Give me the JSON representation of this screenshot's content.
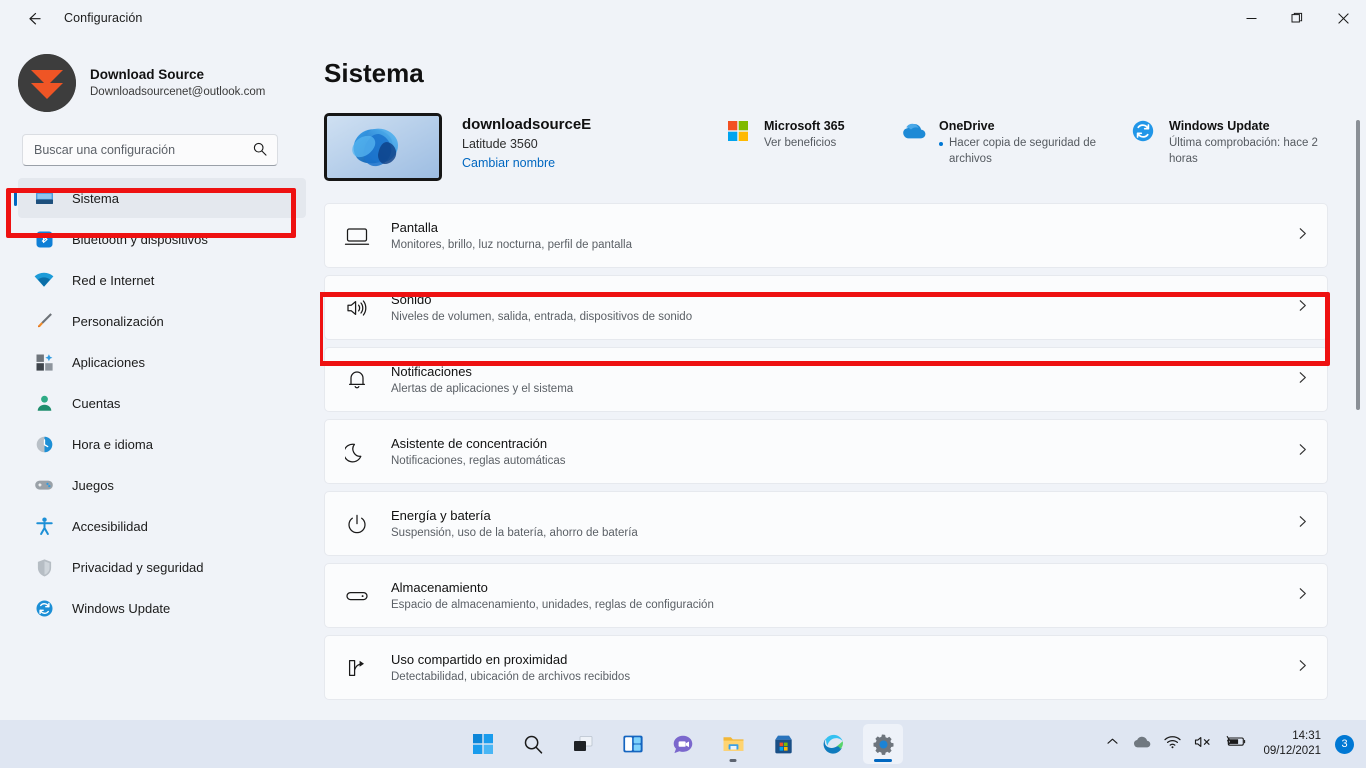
{
  "window": {
    "title": "Configuración",
    "back_icon": "back-arrow-icon",
    "minimize_label": "—",
    "maximize_label": "▢",
    "close_label": "✕"
  },
  "account": {
    "name": "Download Source",
    "email": "Downloadsourcenet@outlook.com",
    "avatar_icon": "download-chevrons-avatar"
  },
  "search": {
    "placeholder": "Buscar una configuración",
    "value": "",
    "icon": "search-icon"
  },
  "sidebar": {
    "items": [
      {
        "label": "Sistema",
        "icon": "monitor-icon",
        "selected": true
      },
      {
        "label": "Bluetooth y dispositivos",
        "icon": "bluetooth-icon",
        "selected": false
      },
      {
        "label": "Red e Internet",
        "icon": "wifi-icon",
        "selected": false
      },
      {
        "label": "Personalización",
        "icon": "paintbrush-icon",
        "selected": false
      },
      {
        "label": "Aplicaciones",
        "icon": "apps-grid-icon",
        "selected": false
      },
      {
        "label": "Cuentas",
        "icon": "person-icon",
        "selected": false
      },
      {
        "label": "Hora e idioma",
        "icon": "clock-icon",
        "selected": false
      },
      {
        "label": "Juegos",
        "icon": "gamepad-icon",
        "selected": false
      },
      {
        "label": "Accesibilidad",
        "icon": "accessibility-person-icon",
        "selected": false
      },
      {
        "label": "Privacidad y seguridad",
        "icon": "shield-icon",
        "selected": false
      },
      {
        "label": "Windows Update",
        "icon": "update-refresh-icon",
        "selected": false
      }
    ]
  },
  "main": {
    "page_title": "Sistema",
    "device": {
      "name": "downloadsourceE",
      "model": "Latitude 3560",
      "rename_link": "Cambiar nombre",
      "thumbnail_icon": "windows-bloom-wallpaper"
    },
    "status_cards": [
      {
        "title": "Microsoft 365",
        "subtitle": "Ver beneficios",
        "icon": "microsoft-logo-icon",
        "bulleted": false
      },
      {
        "title": "OneDrive",
        "subtitle": "Hacer copia de seguridad de archivos",
        "icon": "onedrive-cloud-icon",
        "bulleted": true
      },
      {
        "title": "Windows Update",
        "subtitle": "Última comprobación: hace 2 horas",
        "icon": "update-refresh-icon",
        "bulleted": false
      }
    ],
    "settings_rows": [
      {
        "title": "Pantalla",
        "subtitle": "Monitores, brillo, luz nocturna, perfil de pantalla",
        "icon": "display-monitor-icon",
        "highlighted": false
      },
      {
        "title": "Sonido",
        "subtitle": "Niveles de volumen, salida, entrada, dispositivos de sonido",
        "icon": "speaker-volume-icon",
        "highlighted": true
      },
      {
        "title": "Notificaciones",
        "subtitle": "Alertas de aplicaciones y el sistema",
        "icon": "bell-icon",
        "highlighted": false
      },
      {
        "title": "Asistente de concentración",
        "subtitle": "Notificaciones, reglas automáticas",
        "icon": "moon-icon",
        "highlighted": false
      },
      {
        "title": "Energía y batería",
        "subtitle": "Suspensión, uso de la batería, ahorro de batería",
        "icon": "power-icon",
        "highlighted": false
      },
      {
        "title": "Almacenamiento",
        "subtitle": "Espacio de almacenamiento, unidades, reglas de configuración",
        "icon": "drive-icon",
        "highlighted": false
      },
      {
        "title": "Uso compartido en proximidad",
        "subtitle": "Detectabilidad, ubicación de archivos recibidos",
        "icon": "share-icon",
        "highlighted": false
      }
    ],
    "chevron_glyph": "›"
  },
  "taskbar": {
    "buttons": [
      {
        "name": "start-button",
        "icon": "windows-start-icon"
      },
      {
        "name": "search-button",
        "icon": "search-icon"
      },
      {
        "name": "task-view-button",
        "icon": "task-view-icon"
      },
      {
        "name": "widgets-button",
        "icon": "widgets-icon"
      },
      {
        "name": "teams-chat-button",
        "icon": "teams-chat-icon"
      },
      {
        "name": "file-explorer-button",
        "icon": "file-explorer-icon"
      },
      {
        "name": "microsoft-store-button",
        "icon": "microsoft-store-icon"
      },
      {
        "name": "edge-button",
        "icon": "edge-browser-icon"
      },
      {
        "name": "settings-button",
        "icon": "settings-gear-icon"
      }
    ],
    "tray": {
      "overflow_icon": "chevron-up-icon",
      "onedrive_icon": "onedrive-cloud-icon",
      "wifi_icon": "wifi-icon",
      "volume_icon": "speaker-muted-icon",
      "battery_icon": "battery-charging-icon",
      "time": "14:31",
      "date": "09/12/2021",
      "notification_count": "3"
    }
  },
  "colors": {
    "accent": "#0067c0",
    "highlight_box": "#ee1111",
    "background": "#f0f3f8",
    "card": "#fbfcfd",
    "taskbar": "#dfe6f2"
  }
}
